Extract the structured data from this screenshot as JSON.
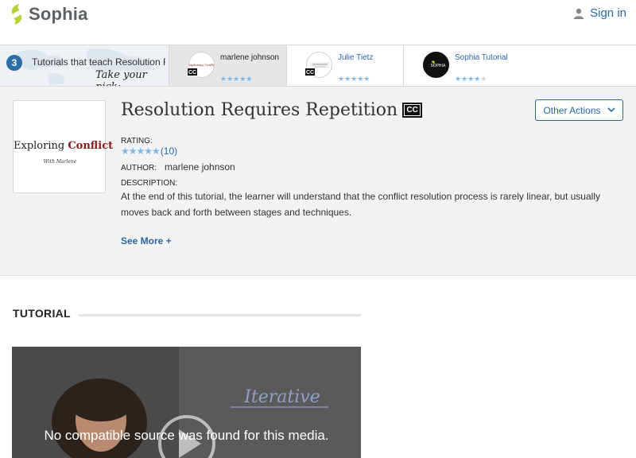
{
  "header": {
    "logo_text": "Sophia",
    "signin_label": "Sign in"
  },
  "strip": {
    "count": "3",
    "label": "Tutorials that teach Resolution Requires Repetition",
    "pick_label": "Take your pick:",
    "cards": [
      {
        "name": "marlene johnson",
        "stars_on": "★★★★★",
        "stars_off": "",
        "cc": "CC"
      },
      {
        "name": "Julie Tietz",
        "stars_on": "★★★★★",
        "stars_off": "",
        "cc": "CC"
      },
      {
        "name": "Sophia Tutorial",
        "stars_on": "★★★★",
        "stars_off": "★",
        "thumb_text": "SOPHIA"
      }
    ]
  },
  "tutorial": {
    "cover_word1": "Exploring ",
    "cover_word2": "Conflict",
    "cover_sub": "With Marlene",
    "title": "Resolution Requires Repetition",
    "cc": "CC",
    "other_actions_label": "Other Actions",
    "rating_label": "RATING:",
    "rating_stars": "★★★★★",
    "rating_count": "(10)",
    "author_label": "AUTHOR:",
    "author": "marlene johnson",
    "description_label": "DESCRIPTION:",
    "description": "At the end of this tutorial, the learner will understand that the conflict resolution process is rarely linear, but usually moves back and forth between stages and techniques.",
    "see_more_label": "See More +"
  },
  "section": {
    "title": "TUTORIAL"
  },
  "video": {
    "whiteboard_text": "Iterative",
    "message": "No compatible source was found for this media."
  },
  "colors": {
    "brand_green": "#b5d334",
    "link_blue": "#2868a8",
    "star_blue": "#7fb8e6"
  }
}
